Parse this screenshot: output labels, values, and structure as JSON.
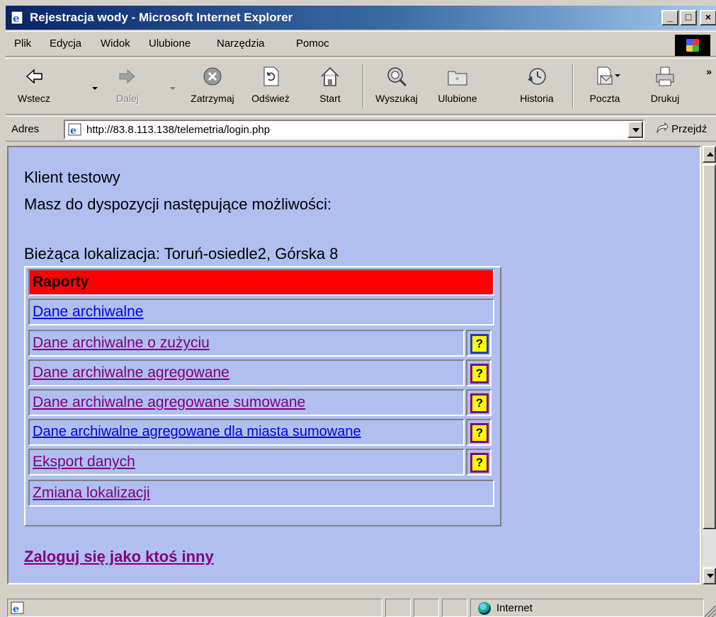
{
  "window": {
    "title": "Rejestracja wody - Microsoft Internet Explorer",
    "minimize": "_",
    "maximize": "□",
    "close": "×"
  },
  "menubar": {
    "items": [
      "Plik",
      "Edycja",
      "Widok",
      "Ulubione",
      "Narzędzia",
      "Pomoc"
    ]
  },
  "toolbar": {
    "back": "Wstecz",
    "forward": "Dalej",
    "stop": "Zatrzymaj",
    "refresh": "Odśwież",
    "home": "Start",
    "search": "Wyszukaj",
    "favorites": "Ulubione",
    "history": "Historia",
    "mail": "Poczta",
    "print": "Drukuj",
    "more": "»"
  },
  "addressbar": {
    "label": "Adres",
    "url": "http://83.8.113.138/telemetria/login.php",
    "go": "Przejdź"
  },
  "page": {
    "client": "Klient testowy",
    "options_intro": "Masz do dyspozycji następujące możliwości:",
    "location": "Bieżąca lokalizacja: Toruń-osiedle2, Górska 8",
    "reports_header": "Raporty",
    "links": [
      "Dane archiwalne",
      "Dane archiwalne o zużyciu",
      "Dane archiwalne agregowane",
      "Dane archiwalne agregowane sumowane",
      "Dane archiwalne agregowane dla miasta sumowane",
      "Eksport danych",
      "Zmiana lokalizacji"
    ],
    "help_mark": "?",
    "login_other": "Zaloguj się jako ktoś inny"
  },
  "statusbar": {
    "zone": "Internet"
  }
}
